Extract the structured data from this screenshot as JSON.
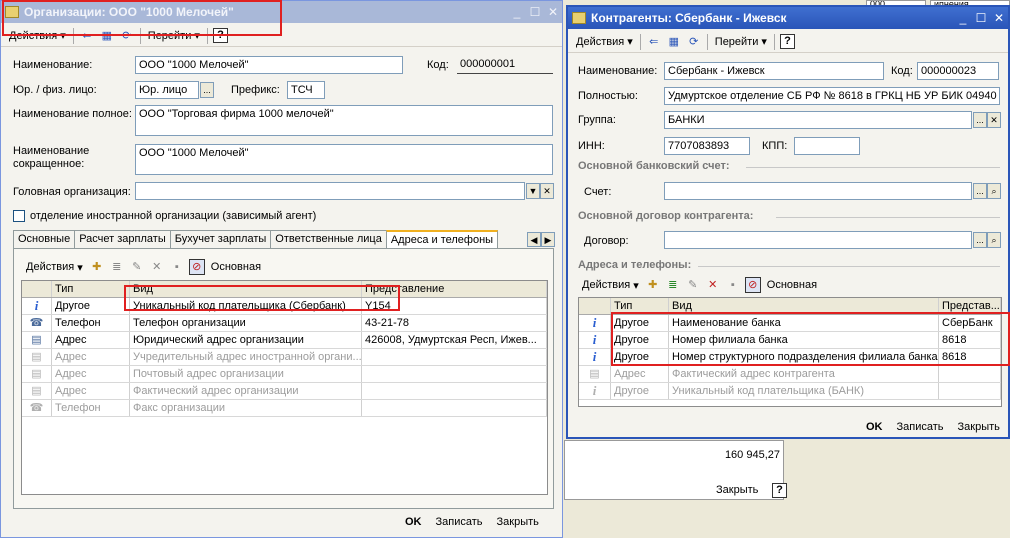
{
  "bg": {
    "topright_fields": [
      "000",
      "ипнения"
    ],
    "total_value": "160 945,27",
    "close_label": "Закрыть",
    "help_label": "?"
  },
  "org": {
    "title": "Организации: ООО \"1000 Мелочей\"",
    "toolbar": {
      "actions": "Действия",
      "goto": "Перейти",
      "help": "?"
    },
    "name_label": "Наименование:",
    "name_value": "ООО \"1000 Мелочей\"",
    "code_label": "Код:",
    "code_value": "000000001",
    "legal_label": "Юр. / физ. лицо:",
    "legal_value": "Юр. лицо",
    "prefix_label": "Префикс:",
    "prefix_value": "ТСЧ",
    "fullname_label": "Наименование полное:",
    "fullname_value": "ООО \"Торговая фирма 1000 мелочей\"",
    "shortname_label": "Наименование сокращенное:",
    "shortname_value": "ООО \"1000 Мелочей\"",
    "head_label": "Головная организация:",
    "head_value": "",
    "foreign_label": "отделение иностранной организации (зависимый агент)",
    "tabs": [
      "Основные",
      "Расчет зарплаты",
      "Бухучет зарплаты",
      "Ответственные лица",
      "Адреса и телефоны"
    ],
    "grid_actions": "Действия",
    "grid_main": "Основная",
    "cols": [
      "Тип",
      "Вид",
      "Представление"
    ],
    "rows": [
      {
        "icon": "info-icon",
        "type": "Другое",
        "kind": "Уникальный код плательщика (Сбербанк)",
        "value": "Y154",
        "grey": false
      },
      {
        "icon": "phone-icon",
        "type": "Телефон",
        "kind": "Телефон организации",
        "value": "43-21-78",
        "grey": false
      },
      {
        "icon": "address-icon",
        "type": "Адрес",
        "kind": "Юридический адрес организации",
        "value": "426008, Удмуртская Респ, Ижев...",
        "grey": false
      },
      {
        "icon": "address-icon",
        "type": "Адрес",
        "kind": "Учредительный адрес иностранной органи...",
        "value": "",
        "grey": true
      },
      {
        "icon": "address-icon",
        "type": "Адрес",
        "kind": "Почтовый адрес организации",
        "value": "",
        "grey": true
      },
      {
        "icon": "address-icon",
        "type": "Адрес",
        "kind": "Фактический адрес организации",
        "value": "",
        "grey": true
      },
      {
        "icon": "phone-icon",
        "type": "Телефон",
        "kind": "Факс организации",
        "value": "",
        "grey": true
      }
    ],
    "ok": "OK",
    "save": "Записать",
    "close": "Закрыть"
  },
  "cp": {
    "title": "Контрагенты: Сбербанк - Ижевск",
    "toolbar": {
      "actions": "Действия",
      "goto": "Перейти",
      "help": "?"
    },
    "name_label": "Наименование:",
    "name_value": "Сбербанк - Ижевск",
    "code_label": "Код:",
    "code_value": "000000023",
    "full_label": "Полностью:",
    "full_value": "Удмуртское отделение СБ РФ № 8618 в ГРКЦ НБ УР БИК 04940",
    "group_label": "Группа:",
    "group_value": "БАНКИ",
    "inn_label": "ИНН:",
    "inn_value": "7707083893",
    "kpp_label": "КПП:",
    "kpp_value": "",
    "bank_section": "Основной банковский счет:",
    "account_label": "Счет:",
    "contract_section": "Основной договор контрагента:",
    "contract_label": "Договор:",
    "addr_section": "Адреса и телефоны:",
    "grid_actions": "Действия",
    "grid_main": "Основная",
    "cols": [
      "Тип",
      "Вид",
      "Представ..."
    ],
    "rows": [
      {
        "icon": "info-icon",
        "type": "Другое",
        "kind": "Наименование банка",
        "value": "СберБанк",
        "grey": false
      },
      {
        "icon": "info-icon",
        "type": "Другое",
        "kind": "Номер филиала банка",
        "value": "8618",
        "grey": false
      },
      {
        "icon": "info-icon",
        "type": "Другое",
        "kind": "Номер структурного подразделения филиала банка",
        "value": "8618",
        "grey": false
      },
      {
        "icon": "address-icon",
        "type": "Адрес",
        "kind": "Фактический адрес контрагента",
        "value": "",
        "grey": true
      },
      {
        "icon": "info-icon",
        "type": "Другое",
        "kind": "Уникальный код плательщика (БАНК)",
        "value": "",
        "grey": true
      }
    ],
    "ok": "OK",
    "save": "Записать",
    "close": "Закрыть"
  },
  "colors": {
    "highlight": "#e02020",
    "active_title": "#2a55b8"
  }
}
